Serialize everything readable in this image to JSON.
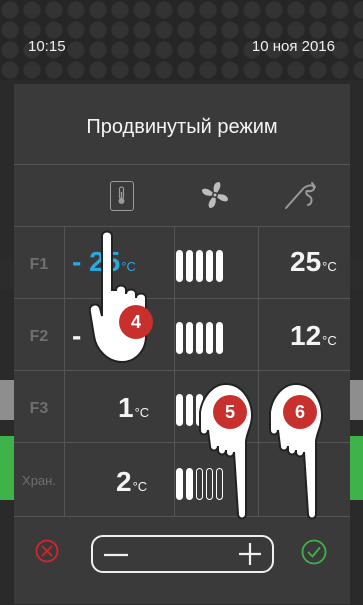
{
  "status": {
    "time": "10:15",
    "date": "10 ноя 2016"
  },
  "dialog": {
    "title": "Продвинутый режим",
    "columns": {
      "temperature_icon": "thermometer-icon",
      "fan_icon": "fan-icon",
      "defrost_icon": "defrost-icon"
    },
    "rows": [
      {
        "label": "F1",
        "temp_value": "- 25",
        "temp_unit": "°C",
        "fan_level": 5,
        "fan_max": 5,
        "third_value": "25",
        "third_unit": "°C"
      },
      {
        "label": "F2",
        "temp_value": "-",
        "temp_unit": "",
        "fan_level": 5,
        "fan_max": 5,
        "third_value": "12",
        "third_unit": "°C"
      },
      {
        "label": "F3",
        "temp_value": "1",
        "temp_unit": "°C",
        "fan_level": 5,
        "fan_max": 5,
        "third_value": "",
        "third_unit": "°C"
      },
      {
        "label": "Хран.",
        "temp_value": "2",
        "temp_unit": "°C",
        "fan_level": 2,
        "fan_max": 5,
        "third_value": "",
        "third_unit": ""
      }
    ]
  },
  "controls": {
    "cancel_icon": "cancel-icon",
    "ok_icon": "confirm-icon",
    "minus_icon": "minus-icon",
    "plus_icon": "plus-icon"
  },
  "hints": [
    {
      "number": "4"
    },
    {
      "number": "5"
    },
    {
      "number": "6"
    }
  ],
  "colors": {
    "accent_blue": "#2ba7e0",
    "cancel_red": "#d9232b",
    "ok_green": "#3fb34a",
    "badge_red": "#c8302e"
  }
}
